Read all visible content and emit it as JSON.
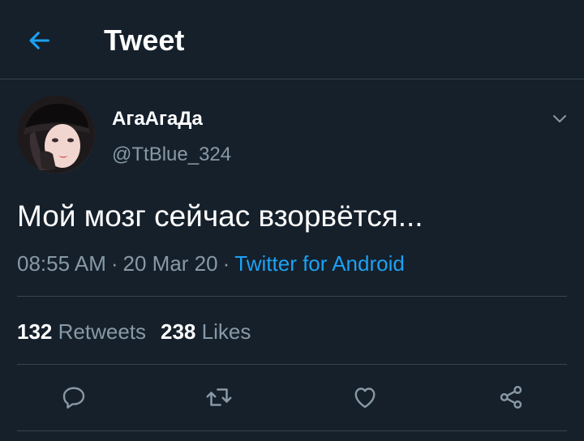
{
  "header": {
    "title": "Tweet",
    "back_icon": "arrow-left-icon"
  },
  "tweet": {
    "author": {
      "display_name": "АгаАгаДа",
      "handle": "@TtBlue_324"
    },
    "text": "Мой мозг сейчас взорвётся...",
    "time": "08:55 AM",
    "date": "20 Mar 20",
    "separator": "·",
    "source": "Twitter for Android",
    "stats": {
      "retweets_count": "132",
      "retweets_label": "Retweets",
      "likes_count": "238",
      "likes_label": "Likes"
    }
  },
  "actions": {
    "icons": [
      "reply-icon",
      "retweet-icon",
      "like-icon",
      "share-icon"
    ]
  },
  "colors": {
    "background": "#15202b",
    "accent": "#1da1f2",
    "secondary_text": "#8899a6",
    "divider": "#38444d"
  }
}
